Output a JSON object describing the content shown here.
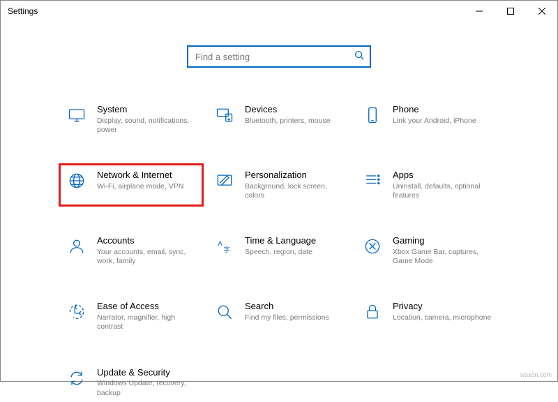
{
  "window": {
    "title": "Settings"
  },
  "search": {
    "placeholder": "Find a setting"
  },
  "cards": [
    {
      "title": "System",
      "desc": "Display, sound, notifications, power"
    },
    {
      "title": "Devices",
      "desc": "Bluetooth, printers, mouse"
    },
    {
      "title": "Phone",
      "desc": "Link your Android, iPhone"
    },
    {
      "title": "Network & Internet",
      "desc": "Wi-Fi, airplane mode, VPN"
    },
    {
      "title": "Personalization",
      "desc": "Background, lock screen, colors"
    },
    {
      "title": "Apps",
      "desc": "Uninstall, defaults, optional features"
    },
    {
      "title": "Accounts",
      "desc": "Your accounts, email, sync, work, family"
    },
    {
      "title": "Time & Language",
      "desc": "Speech, region, date"
    },
    {
      "title": "Gaming",
      "desc": "Xbox Game Bar, captures, Game Mode"
    },
    {
      "title": "Ease of Access",
      "desc": "Narrator, magnifier, high contrast"
    },
    {
      "title": "Search",
      "desc": "Find my files, permissions"
    },
    {
      "title": "Privacy",
      "desc": "Location, camera, microphone"
    },
    {
      "title": "Update & Security",
      "desc": "Windows Update, recovery, backup"
    }
  ],
  "watermark": "wsxdn.com"
}
